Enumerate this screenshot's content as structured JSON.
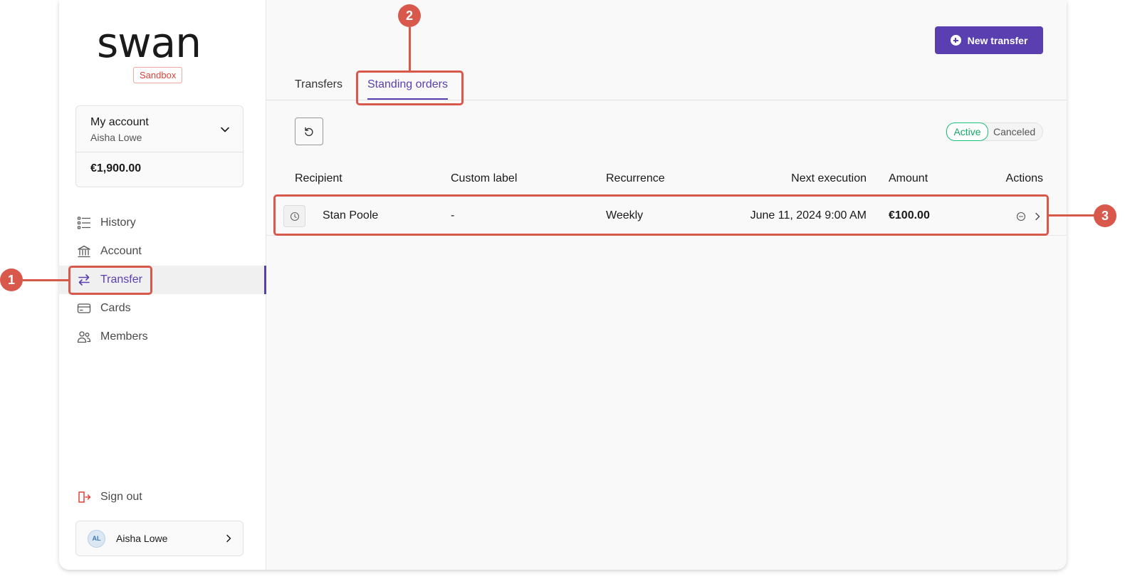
{
  "brand": {
    "logo_text": "swan",
    "environment": "Sandbox"
  },
  "account": {
    "name": "My account",
    "holder": "Aisha Lowe",
    "balance": "€1,900.00"
  },
  "nav": [
    {
      "label": "History",
      "icon": "history-icon"
    },
    {
      "label": "Account",
      "icon": "bank-icon"
    },
    {
      "label": "Transfer",
      "icon": "transfer-arrows-icon",
      "active": true
    },
    {
      "label": "Cards",
      "icon": "card-icon"
    },
    {
      "label": "Members",
      "icon": "members-icon"
    }
  ],
  "signout_label": "Sign out",
  "user": {
    "initials": "AL",
    "name": "Aisha Lowe"
  },
  "actions": {
    "new_transfer_label": "New transfer"
  },
  "tabs": [
    {
      "label": "Transfers",
      "active": false
    },
    {
      "label": "Standing orders",
      "active": true
    }
  ],
  "filter": {
    "active_label": "Active",
    "canceled_label": "Canceled",
    "selected": "Active"
  },
  "table": {
    "columns": [
      "Recipient",
      "Custom label",
      "Recurrence",
      "Next execution",
      "Amount",
      "Actions"
    ],
    "rows": [
      {
        "recipient": "Stan Poole",
        "custom_label": "-",
        "recurrence": "Weekly",
        "next_execution": "June 11, 2024 9:00 AM",
        "amount": "€100.00"
      }
    ]
  },
  "annotations": [
    "1",
    "2",
    "3"
  ],
  "colors": {
    "accent": "#5a3fb0",
    "annotation": "#d8594b",
    "active_status": "#12a867",
    "sandbox_badge": "#e0433a"
  }
}
